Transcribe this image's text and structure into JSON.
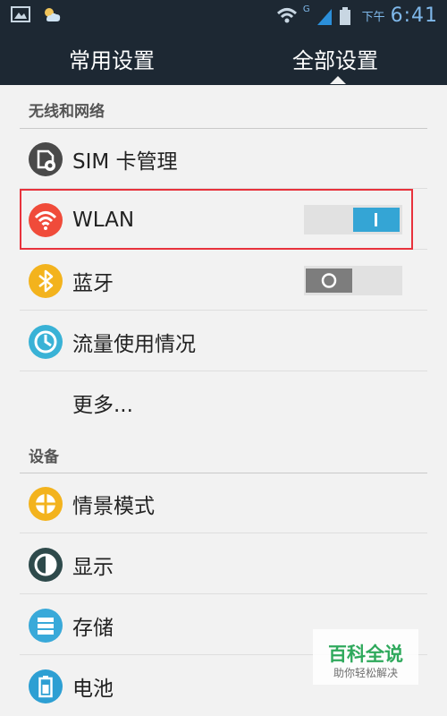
{
  "status_bar": {
    "time_label": "下午",
    "time": "6:41",
    "network_type": "G",
    "left_icons": [
      "image-icon",
      "weather-icon"
    ],
    "right_icons": [
      "wifi-icon",
      "signal-icon",
      "battery-icon"
    ]
  },
  "tabs": [
    {
      "label": "常用设置",
      "selected": false
    },
    {
      "label": "全部设置",
      "selected": true
    }
  ],
  "sections": [
    {
      "header": "无线和网络",
      "items": [
        {
          "label": "SIM 卡管理",
          "icon": "sim-card-icon",
          "icon_color": "#4a4a4a"
        },
        {
          "label": "WLAN",
          "icon": "wifi-icon",
          "icon_color": "#f04b3a",
          "toggle": "on"
        },
        {
          "label": "蓝牙",
          "icon": "bluetooth-icon",
          "icon_color": "#f3b31d",
          "toggle": "off"
        },
        {
          "label": "流量使用情况",
          "icon": "data-usage-icon",
          "icon_color": "#39b2d6"
        },
        {
          "label": "更多...",
          "icon": null
        }
      ]
    },
    {
      "header": "设备",
      "items": [
        {
          "label": "情景模式",
          "icon": "sound-profile-icon",
          "icon_color": "#f3b31d"
        },
        {
          "label": "显示",
          "icon": "display-icon",
          "icon_color": "#2e4a4b"
        },
        {
          "label": "存储",
          "icon": "storage-icon",
          "icon_color": "#39a9d9"
        },
        {
          "label": "电池",
          "icon": "battery-settings-icon",
          "icon_color": "#2d9fd3"
        }
      ]
    }
  ],
  "highlight_color": "#e8323c",
  "watermark": {
    "title": "百科全说",
    "subtitle": "助你轻松解决"
  }
}
